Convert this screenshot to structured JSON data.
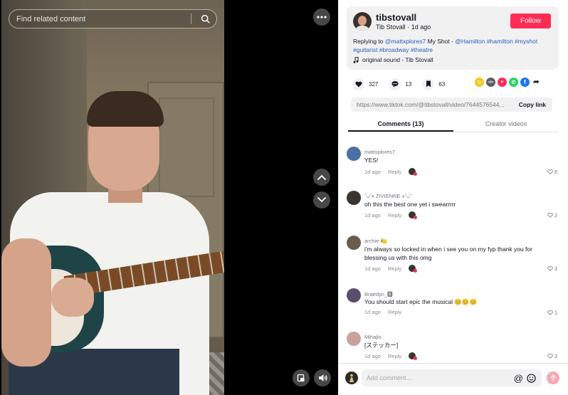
{
  "search": {
    "placeholder": "Find related content"
  },
  "author": {
    "username": "tibstovall",
    "display_name": "Tib Stovall",
    "time_ago": "1d ago",
    "follow_label": "Follow"
  },
  "description": {
    "reply_prefix": "Replying to ",
    "reply_user": "@mattxplores7",
    "text": " My Shot - ",
    "tags": [
      "@Hamilton",
      "#hamilton",
      "#myshot",
      "#guitarist",
      "#broadway",
      "#theatre"
    ],
    "sound": "original sound - Tib Stovall"
  },
  "stats": {
    "likes": "327",
    "comments": "13",
    "saves": "63"
  },
  "share_icons": [
    {
      "name": "repost-icon",
      "color": "#fcc419",
      "glyph": "↻"
    },
    {
      "name": "embed-icon",
      "color": "#5e5e63",
      "glyph": "</>"
    },
    {
      "name": "friends-send-icon",
      "color": "#fe2c55",
      "glyph": "▼"
    },
    {
      "name": "whatsapp-icon",
      "color": "#25d366",
      "glyph": "✆"
    },
    {
      "name": "facebook-icon",
      "color": "#1877f2",
      "glyph": "f"
    },
    {
      "name": "more-share-icon",
      "color": "#ffffff",
      "glyph": "➦"
    }
  ],
  "link": {
    "url": "https://www.tiktok.com/@tibstovall/video/7644576544...",
    "copy_label": "Copy link"
  },
  "tabs": [
    {
      "label": "Comments (13)"
    },
    {
      "label": "Creator videos"
    }
  ],
  "comments": [
    {
      "user": "mattxplores7",
      "text": "YES!",
      "time": "1d ago",
      "reply": "Reply",
      "likes": "6",
      "avatar_color": "#4a6fa5"
    },
    {
      "user": "ᵔ̀ᴗᵔ́⭑ ZIVIENNE ⭑ᵔ̀ᴗᵔ́",
      "text": "oh this the best one yet i swearrrrr",
      "time": "1d ago",
      "reply": "Reply",
      "likes": "2",
      "avatar_color": "#3b3530"
    },
    {
      "user": "archie 🍋",
      "text": "i'm always so locked in when i see you on my fyp thank you for blessing us with this omg",
      "time": "1d ago",
      "reply": "Reply",
      "likes": "3",
      "avatar_color": "#6b5b4b"
    },
    {
      "user": "Braedyn_🅱",
      "text": "You should start epic the musical 😊😊😊",
      "time": "1d ago",
      "reply": "Reply",
      "likes": "1",
      "avatar_color": "#5a4e6c"
    },
    {
      "user": "Mihajlo",
      "text": "[ステッカー]",
      "time": "1d ago",
      "reply": "Reply",
      "likes": "3",
      "avatar_color": "#c9a29a"
    }
  ],
  "comment_input": {
    "placeholder": "Add comment..."
  }
}
